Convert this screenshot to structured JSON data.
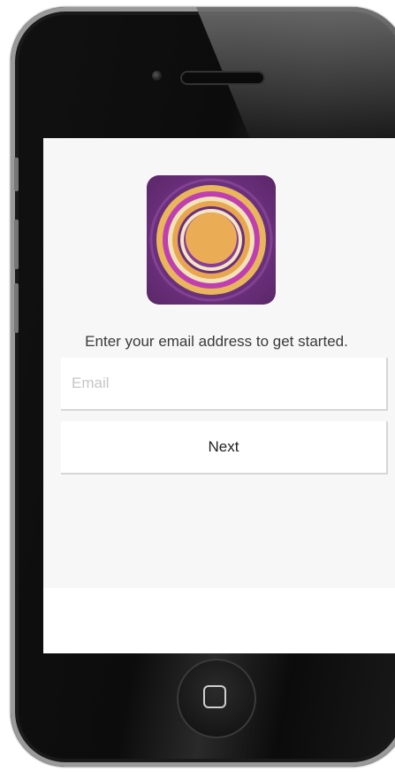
{
  "app": {
    "prompt_text": "Enter your email address to get started.",
    "logo_icon": "concentric-circles-logo-icon"
  },
  "form": {
    "email_placeholder": "Email",
    "email_value": "",
    "next_label": "Next"
  },
  "device": {
    "home_button_icon": "home-square-icon"
  },
  "colors": {
    "logo_background": "#6e3180",
    "logo_gold": "#e7a64f",
    "logo_magenta": "#c03fb0",
    "logo_cream": "#f1e2b8",
    "screen_background": "#f7f7f7",
    "field_background": "#ffffff"
  }
}
